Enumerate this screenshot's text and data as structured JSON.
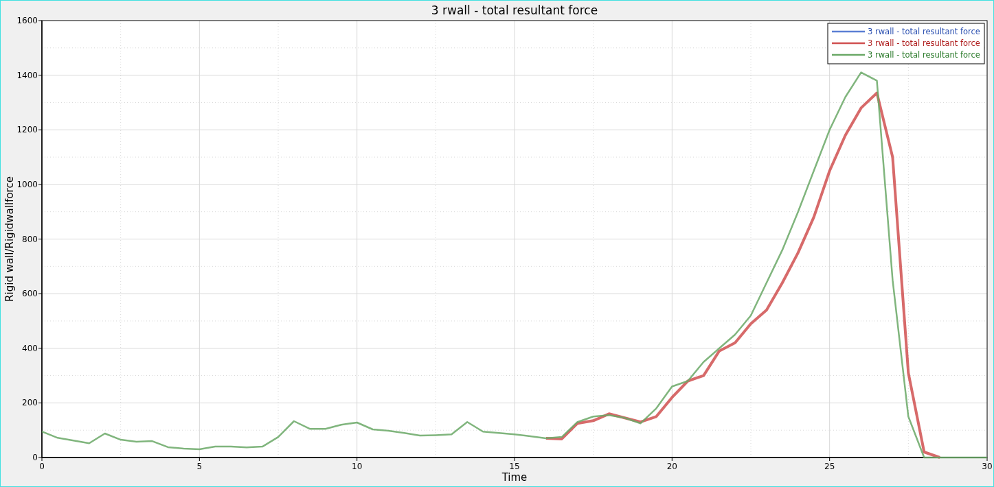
{
  "chart_data": {
    "type": "line",
    "title": "3 rwall - total resultant force",
    "xlabel": "Time",
    "ylabel": "Rigid wall/Rigidwallforce",
    "x": [
      0,
      0.5,
      1,
      1.5,
      2,
      2.5,
      3,
      3.5,
      4,
      4.5,
      5,
      5.5,
      6,
      6.5,
      7,
      7.5,
      8,
      8.5,
      9,
      9.5,
      10,
      10.5,
      11,
      11.5,
      12,
      12.5,
      13,
      13.5,
      14,
      14.5,
      15,
      15.5,
      16,
      16.5,
      17,
      17.5,
      18,
      18.5,
      19,
      19.5,
      20,
      20.5,
      21,
      21.5,
      22,
      22.5,
      23,
      23.5,
      24,
      24.5,
      25,
      25.5,
      26,
      26.5,
      27,
      27.5,
      28,
      28.5,
      29,
      29.5,
      30
    ],
    "series": [
      {
        "name": "3 rwall - total resultant force",
        "color": "#5b7fd4",
        "values": [
          null,
          null,
          null,
          null,
          null,
          null,
          null,
          null,
          null,
          null,
          null,
          null,
          null,
          null,
          null,
          null,
          null,
          null,
          null,
          null,
          null,
          null,
          null,
          null,
          null,
          null,
          null,
          null,
          null,
          null,
          null,
          null,
          null,
          null,
          null,
          null,
          null,
          null,
          null,
          null,
          null,
          null,
          null,
          null,
          null,
          null,
          null,
          null,
          null,
          null,
          null,
          null,
          null,
          null,
          null,
          null,
          null,
          null,
          null,
          null,
          null
        ]
      },
      {
        "name": "3 rwall - total resultant force",
        "color": "#d05050",
        "values": [
          null,
          null,
          null,
          null,
          null,
          null,
          null,
          null,
          null,
          null,
          null,
          null,
          null,
          null,
          null,
          null,
          null,
          null,
          null,
          null,
          null,
          null,
          null,
          null,
          null,
          null,
          null,
          null,
          null,
          null,
          null,
          null,
          70,
          68,
          125,
          135,
          160,
          145,
          130,
          150,
          220,
          280,
          300,
          390,
          420,
          490,
          540,
          640,
          750,
          880,
          1050,
          1180,
          1280,
          1335,
          1100,
          310,
          20,
          0,
          null,
          null,
          null
        ]
      },
      {
        "name": "3 rwall - total resultant force",
        "color": "#6aa866",
        "values": [
          95,
          72,
          62,
          52,
          88,
          65,
          58,
          60,
          38,
          33,
          30,
          40,
          40,
          37,
          40,
          75,
          133,
          105,
          105,
          120,
          128,
          103,
          98,
          90,
          80,
          82,
          85,
          130,
          95,
          90,
          85,
          78,
          70,
          75,
          130,
          150,
          155,
          145,
          125,
          180,
          260,
          280,
          350,
          400,
          450,
          520,
          640,
          760,
          900,
          1050,
          1200,
          1320,
          1410,
          1380,
          650,
          150,
          0,
          0,
          0,
          0,
          0
        ]
      }
    ],
    "grid": true,
    "xlim": [
      0,
      30
    ],
    "ylim": [
      0,
      1600
    ],
    "xticks": [
      0,
      5,
      10,
      15,
      20,
      25,
      30
    ],
    "yticks": [
      0,
      200,
      400,
      600,
      800,
      1000,
      1200,
      1400,
      1600
    ]
  }
}
